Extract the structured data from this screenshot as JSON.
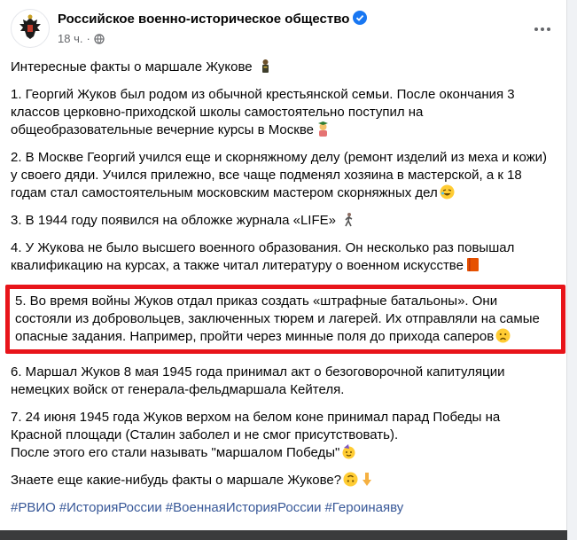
{
  "post": {
    "author": "Российское военно-историческое общество",
    "time": "18 ч.",
    "separator": "·",
    "intro": "Интересные факты о маршале Жукове",
    "facts": [
      "1. Георгий Жуков был родом из обычной крестьянской семьи. После окончания 3 классов церковно-приходской школы самостоятельно поступил на общеобразовательные вечерние курсы в Москве",
      "2. В Москве Георгий учился еще и скорняжному делу (ремонт изделий из меха и кожи) у своего дяди. Учился прилежно, все чаще подменял хозяина в мастерской, а к 18 годам стал самостоятельным московским мастером скорняжных дел",
      "3. В 1944 году появился на обложке журнала «LIFE»",
      "4. У Жукова не было высшего военного образования. Он несколько раз повышал квалификацию на курсах, а также читал литературу о военном искусстве",
      "5. Во время войны Жуков отдал приказ создать «штрафные батальоны». Они состояли из добровольцев, заключенных тюрем и лагерей. Их отправляли на самые опасные задания. Например, пройти через минные поля до прихода саперов",
      "6. Маршал Жуков 8 мая 1945 года принимал акт о безоговорочной капитуляции немецких войск от генерала-фельдмаршала Кейтеля.",
      "7. 24 июня 1945 года Жуков верхом на белом коне принимал парад Победы на Красной площади (Сталин заболел и не смог присутствовать)."
    ],
    "fact7_extra": "После этого его стали называть \"маршалом Победы\"",
    "question": "Знаете еще какие-нибудь факты о маршале Жукове?",
    "hashtags": [
      "#РВИО",
      "#ИсторияРоссии",
      "#ВоеннаяИсторияРоссии",
      "#Героинаяву"
    ]
  },
  "colors": {
    "highlight_border": "#e8141a",
    "link": "#385898",
    "verified": "#1877f2"
  }
}
